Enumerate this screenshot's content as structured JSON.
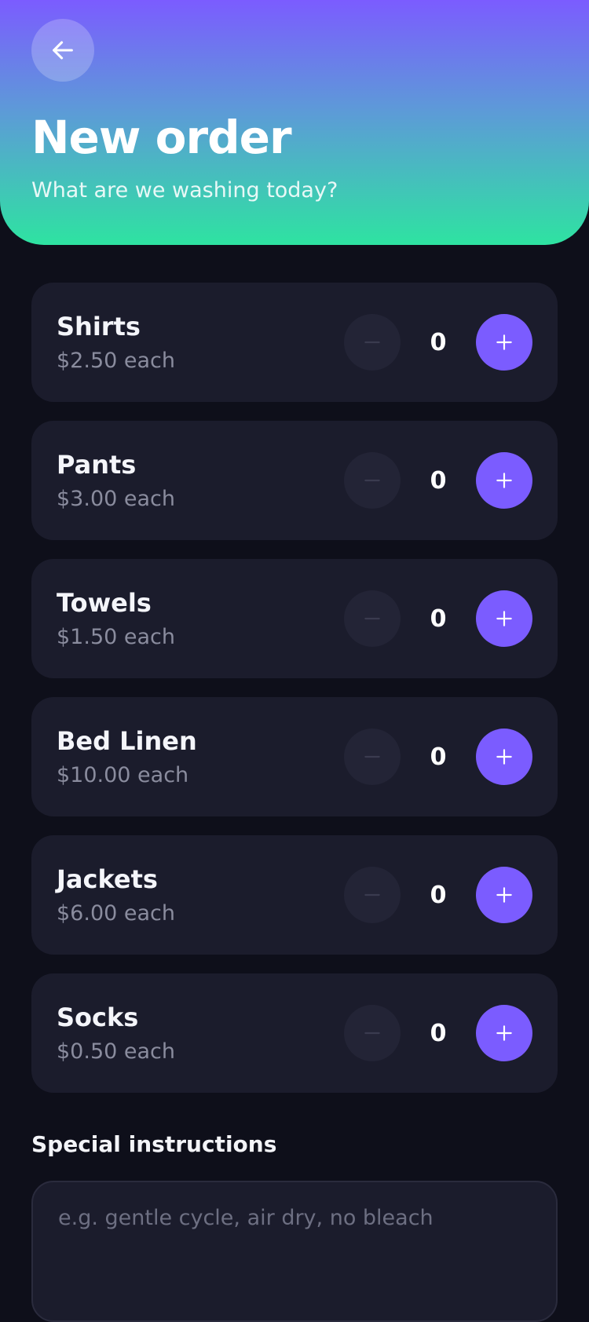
{
  "header": {
    "title": "New order",
    "subtitle": "What are we washing today?",
    "back_icon": "arrow-left-icon"
  },
  "colors": {
    "accent": "#7b5cff",
    "gradient_top": "#7b5cff",
    "gradient_bottom": "#2ee3a1",
    "background": "#0e0f1a",
    "card": "#1b1c2c"
  },
  "items": [
    {
      "name": "Shirts",
      "price": "$2.50 each",
      "qty": "0"
    },
    {
      "name": "Pants",
      "price": "$3.00 each",
      "qty": "0"
    },
    {
      "name": "Towels",
      "price": "$1.50 each",
      "qty": "0"
    },
    {
      "name": "Bed Linen",
      "price": "$10.00 each",
      "qty": "0"
    },
    {
      "name": "Jackets",
      "price": "$6.00 each",
      "qty": "0"
    },
    {
      "name": "Socks",
      "price": "$0.50 each",
      "qty": "0"
    }
  ],
  "instructions": {
    "label": "Special instructions",
    "placeholder": "e.g. gentle cycle, air dry, no bleach",
    "value": ""
  }
}
